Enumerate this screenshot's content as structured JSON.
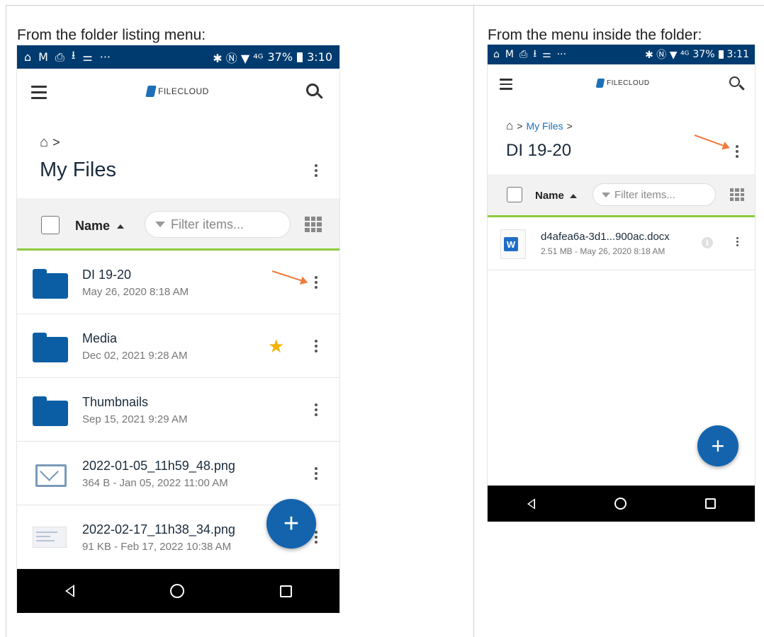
{
  "left": {
    "caption": "From the folder listing menu:",
    "status": {
      "icons": [
        "⌂",
        "M",
        "⎙",
        "⭳",
        "⚌",
        "···"
      ],
      "right_icons": "✱ Ⓝ ▼ ⁴ᴳ",
      "battery": "37%",
      "time": "3:10"
    },
    "logo": "FILECLOUD",
    "breadcrumb_sep": ">",
    "title": "My Files",
    "sort_label": "Name",
    "filter_placeholder": "Filter items...",
    "rows": [
      {
        "name": "DI 19-20",
        "meta": "May 26, 2020 8:18 AM",
        "icon": "folder-icon"
      },
      {
        "name": "Media",
        "meta": "Dec 02, 2021 9:28 AM",
        "icon": "folder-icon",
        "starred": true
      },
      {
        "name": "Thumbnails",
        "meta": "Sep 15, 2021 9:29 AM",
        "icon": "folder-icon"
      },
      {
        "name": "2022-01-05_11h59_48.png",
        "meta": "364 B - Jan 05, 2022 11:00 AM",
        "icon": "mail-icon"
      },
      {
        "name": "2022-02-17_11h38_34.png",
        "meta": "91 KB - Feb 17, 2022 10:38 AM",
        "icon": "image-thumbnail"
      }
    ],
    "fab": "+"
  },
  "right": {
    "caption": "From the menu inside the folder:",
    "status": {
      "icons": [
        "⌂",
        "M",
        "⎙",
        "⭳",
        "⚌",
        "···"
      ],
      "right_icons": "✱ Ⓝ ▼ ⁴ᴳ",
      "battery": "37%",
      "time": "3:11"
    },
    "logo": "FILECLOUD",
    "breadcrumb_link": "My Files",
    "breadcrumb_sep": ">",
    "title": "DI 19-20",
    "sort_label": "Name",
    "filter_placeholder": "Filter items...",
    "rows": [
      {
        "name": "d4afea6a-3d1...900ac.docx",
        "meta": "2.51 MB - May 26, 2020 8:18 AM",
        "icon": "word-doc-icon"
      }
    ],
    "word_letter": "W",
    "info_letter": "i",
    "fab": "+"
  },
  "colors": {
    "status_bar": "#003b6f",
    "accent": "#1364ad",
    "divider": "#8ccb3f",
    "annotation_arrow": "#f07b3c",
    "star": "#f5b400"
  }
}
